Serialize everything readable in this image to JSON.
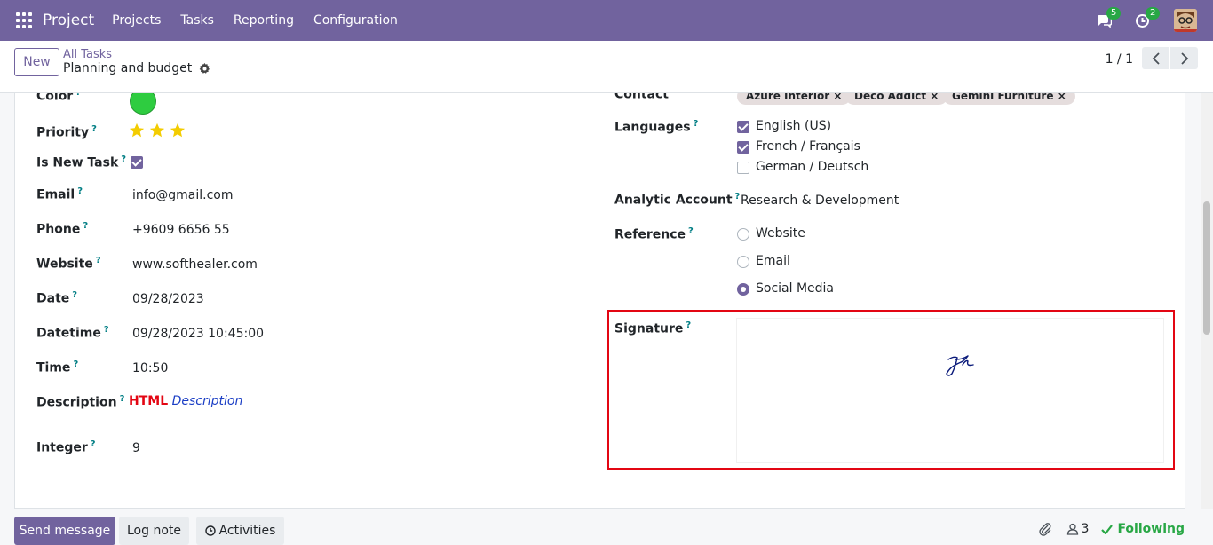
{
  "navbar": {
    "app_name": "Project",
    "menu": [
      "Projects",
      "Tasks",
      "Reporting",
      "Configuration"
    ],
    "messages_count": "5",
    "activities_count": "2"
  },
  "control_panel": {
    "new_label": "New",
    "breadcrumb_parent": "All Tasks",
    "breadcrumb_current": "Planning and budget",
    "pager": "1 / 1"
  },
  "form": {
    "left": {
      "color": {
        "label": "Color",
        "value_color": "#2ecc40"
      },
      "priority": {
        "label": "Priority",
        "stars": 3,
        "star_color": "#f3cc00"
      },
      "is_new_task": {
        "label": "Is New Task",
        "checked": true
      },
      "email": {
        "label": "Email",
        "value": "info@gmail.com"
      },
      "phone": {
        "label": "Phone",
        "value": "+9609 6656 55"
      },
      "website": {
        "label": "Website",
        "value": "www.softhealer.com"
      },
      "date": {
        "label": "Date",
        "value": "09/28/2023"
      },
      "datetime": {
        "label": "Datetime",
        "value": "09/28/2023 10:45:00"
      },
      "time": {
        "label": "Time",
        "value": "10:50"
      },
      "description": {
        "label": "Description",
        "html_word": "HTML",
        "desc_word": "Description"
      },
      "integer": {
        "label": "Integer",
        "value": "9"
      }
    },
    "right": {
      "contact": {
        "label": "Contact",
        "tags": [
          "Azure Interior",
          "Deco Addict",
          "Gemini Furniture"
        ]
      },
      "languages": {
        "label": "Languages",
        "options": [
          {
            "label": "English (US)",
            "checked": true
          },
          {
            "label": "French / Français",
            "checked": true
          },
          {
            "label": "German / Deutsch",
            "checked": false
          }
        ]
      },
      "analytic_account": {
        "label": "Analytic Account",
        "value": "Research & Development"
      },
      "reference": {
        "label": "Reference",
        "options": [
          {
            "label": "Website",
            "selected": false
          },
          {
            "label": "Email",
            "selected": false
          },
          {
            "label": "Social Media",
            "selected": true
          }
        ]
      },
      "signature": {
        "label": "Signature"
      }
    },
    "help_mark": "?"
  },
  "chatter": {
    "send_message": "Send message",
    "log_note": "Log note",
    "activities": "Activities",
    "followers_count": "3",
    "following": "Following"
  },
  "colors": {
    "brand": "#71639e",
    "highlight_border": "#e30613",
    "success": "#28a745"
  }
}
